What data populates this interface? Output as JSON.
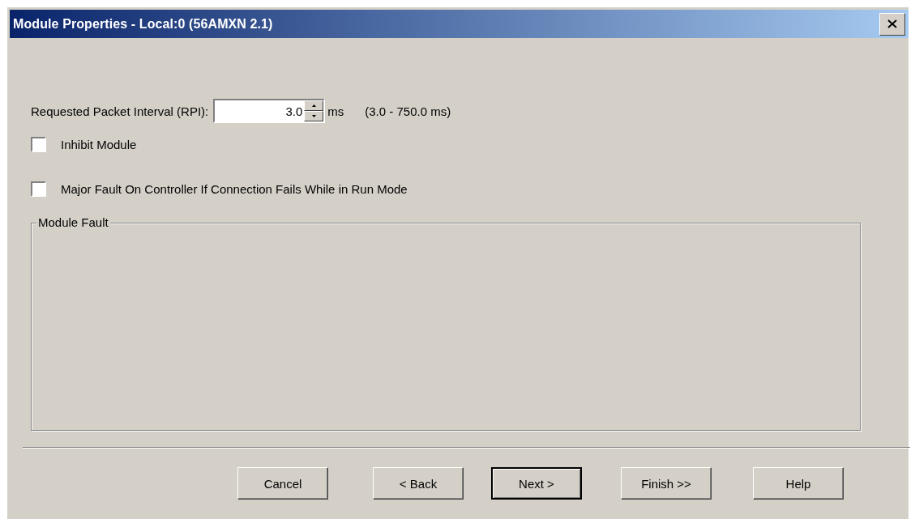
{
  "window": {
    "title": "Module Properties - Local:0 (56AMXN 2.1)"
  },
  "rpi": {
    "label": "Requested Packet Interval (RPI):",
    "value": "3.0",
    "unit": "ms",
    "range": "(3.0 - 750.0 ms)"
  },
  "options": [
    {
      "label": "Inhibit Module",
      "checked": false
    },
    {
      "label": "Major Fault On Controller If Connection Fails While in Run Mode",
      "checked": false
    }
  ],
  "module_fault": {
    "title": "Module Fault"
  },
  "buttons": [
    {
      "label": "Cancel",
      "default": false
    },
    {
      "label": "< Back",
      "default": false
    },
    {
      "label": "Next >",
      "default": true
    },
    {
      "label": "Finish >>",
      "default": false
    },
    {
      "label": "Help",
      "default": false
    }
  ]
}
